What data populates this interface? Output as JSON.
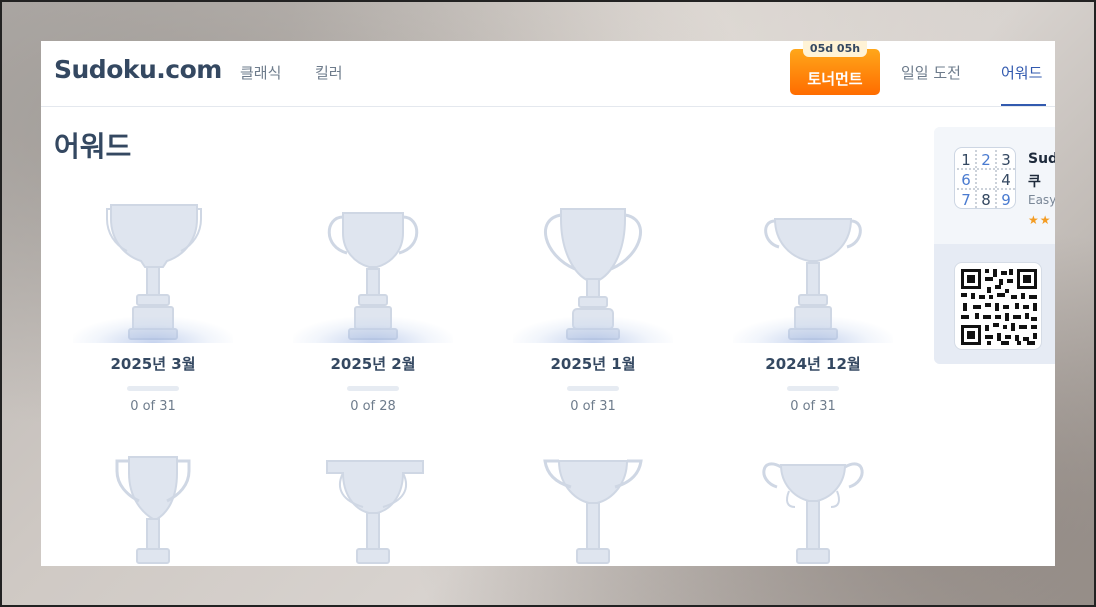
{
  "brand": {
    "logo": "Sudoku.com",
    "accent": "#325aaf",
    "text_dark": "#344861"
  },
  "nav": {
    "classic": "클래식",
    "killer": "킬러",
    "tournament": "토너먼트",
    "tournament_timer": "05d 05h",
    "daily": "일일 도전",
    "awards": "어워드"
  },
  "page": {
    "title": "어워드"
  },
  "trophies": [
    {
      "label": "2025년 3월",
      "count": "0 of 31",
      "progress": 0
    },
    {
      "label": "2025년 2월",
      "count": "0 of 28",
      "progress": 0
    },
    {
      "label": "2025년 1월",
      "count": "0 of 31",
      "progress": 0
    },
    {
      "label": "2024년 12월",
      "count": "0 of 31",
      "progress": 0
    }
  ],
  "side_promo": {
    "app_name": "Sud",
    "app_name_line2": "쿠",
    "app_sub": "Easy",
    "stars": "★★",
    "grid_digits": [
      "1",
      "2",
      "3",
      "6",
      "",
      "4",
      "7",
      "8",
      "9"
    ]
  }
}
